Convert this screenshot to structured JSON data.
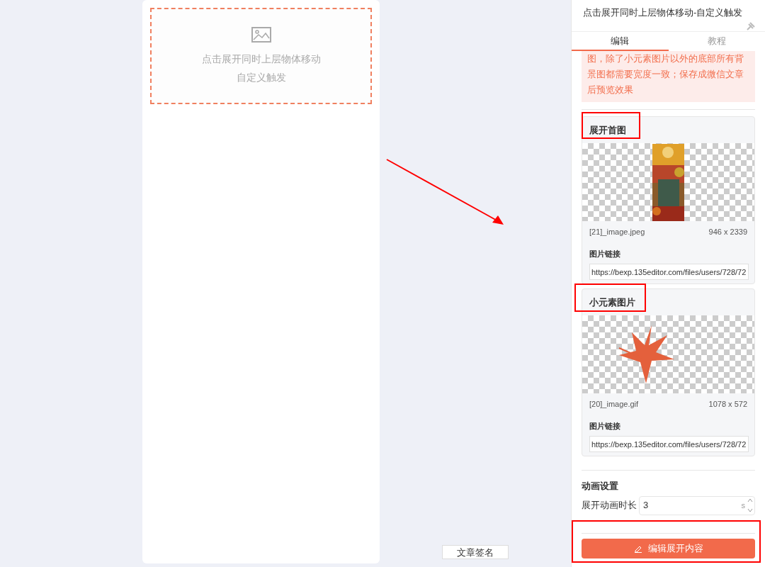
{
  "canvas": {
    "placeholder_lines": [
      "点击展开同时上层物体移动",
      "自定义触发"
    ],
    "signature_button": "文章签名"
  },
  "header": {
    "title": "点击展开同时上层物体移动-自定义触发"
  },
  "tabs": [
    {
      "label": "编辑",
      "selected": true
    },
    {
      "label": "教程",
      "selected": false
    }
  ],
  "notice": "图，除了小元素图片以外的底部所有背景图都需要宽度一致；保存成微信文章后预览效果",
  "image_cards": [
    {
      "title": "展开首图",
      "kind": "poster",
      "file_name": "[21]_image.jpeg",
      "dimensions": "946 x 2339",
      "link_label": "图片链接",
      "link_value": "https://bexp.135editor.com/files/users/728/72"
    },
    {
      "title": "小元素图片",
      "kind": "leaf",
      "file_name": "[20]_image.gif",
      "dimensions": "1078 x 572",
      "link_label": "图片链接",
      "link_value": "https://bexp.135editor.com/files/users/728/72"
    }
  ],
  "animation": {
    "title": "动画设置",
    "label": "展开动画时长",
    "value": "3",
    "unit": "s"
  },
  "edit_button": "编辑展开内容"
}
